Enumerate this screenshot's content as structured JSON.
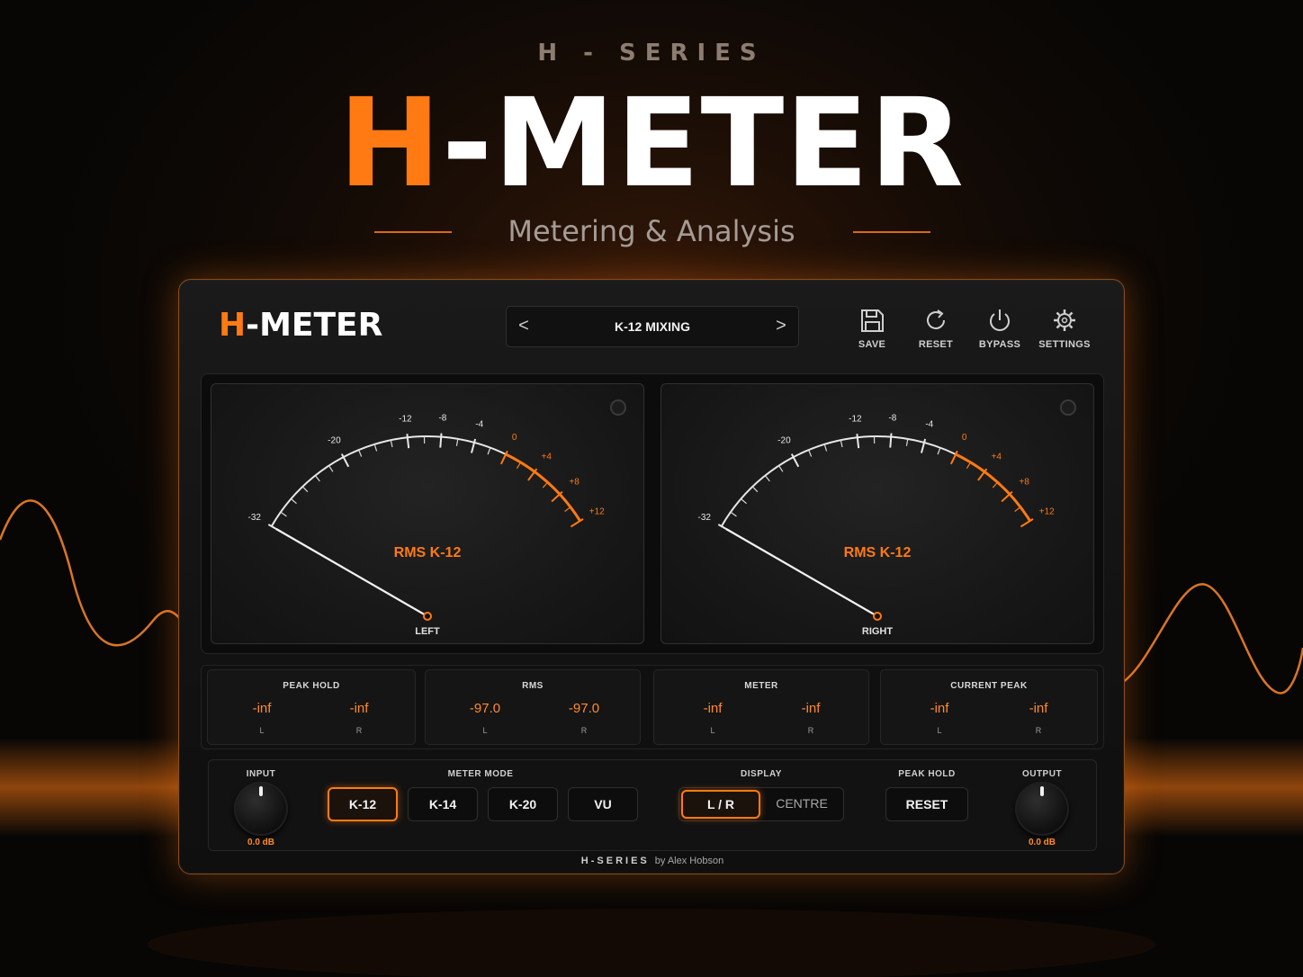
{
  "header": {
    "kicker": "H - SERIES",
    "title_accent": "H",
    "title_rest": "-METER",
    "subtitle": "Metering & Analysis"
  },
  "plugin": {
    "logo_accent": "H",
    "logo_rest": "-METER",
    "preset": {
      "prev": "<",
      "name": "K-12 MIXING",
      "next": ">"
    },
    "toolbar": [
      {
        "label": "SAVE",
        "icon": "save-icon"
      },
      {
        "label": "RESET",
        "icon": "reset-icon"
      },
      {
        "label": "BYPASS",
        "icon": "power-icon"
      },
      {
        "label": "SETTINGS",
        "icon": "gear-icon"
      }
    ],
    "meters": [
      {
        "mode": "RMS  K-12",
        "channel": "LEFT"
      },
      {
        "mode": "RMS  K-12",
        "channel": "RIGHT"
      }
    ],
    "scale": {
      "labels": [
        "-32",
        "-20",
        "-12",
        "-8",
        "-4",
        "0",
        "+4",
        "+8",
        "+12"
      ],
      "warning_start": "0"
    },
    "readouts": [
      {
        "title": "PEAK HOLD",
        "left": "-inf",
        "right": "-inf",
        "l": "L",
        "r": "R"
      },
      {
        "title": "RMS",
        "left": "-97.0",
        "right": "-97.0",
        "l": "L",
        "r": "R"
      },
      {
        "title": "METER",
        "left": "-inf",
        "right": "-inf",
        "l": "L",
        "r": "R"
      },
      {
        "title": "CURRENT PEAK",
        "left": "-inf",
        "right": "-inf",
        "l": "L",
        "r": "R"
      }
    ],
    "controls": {
      "input_label": "INPUT",
      "input_value": "0.0 dB",
      "meter_mode_label": "METER MODE",
      "meter_modes": [
        "K-12",
        "K-14",
        "K-20",
        "VU"
      ],
      "meter_mode_selected": "K-12",
      "display_label": "DISPLAY",
      "display_options": [
        "L / R",
        "CENTRE"
      ],
      "display_selected": "L / R",
      "peak_hold_label": "PEAK HOLD",
      "peak_hold_reset": "RESET",
      "output_label": "OUTPUT",
      "output_value": "0.0 dB"
    },
    "footer": {
      "brand": "H-SERIES",
      "by": "by Alex Hobson"
    }
  },
  "colors": {
    "accent": "#ff7a12",
    "panel": "#151515",
    "text": "#f2f2f2"
  }
}
